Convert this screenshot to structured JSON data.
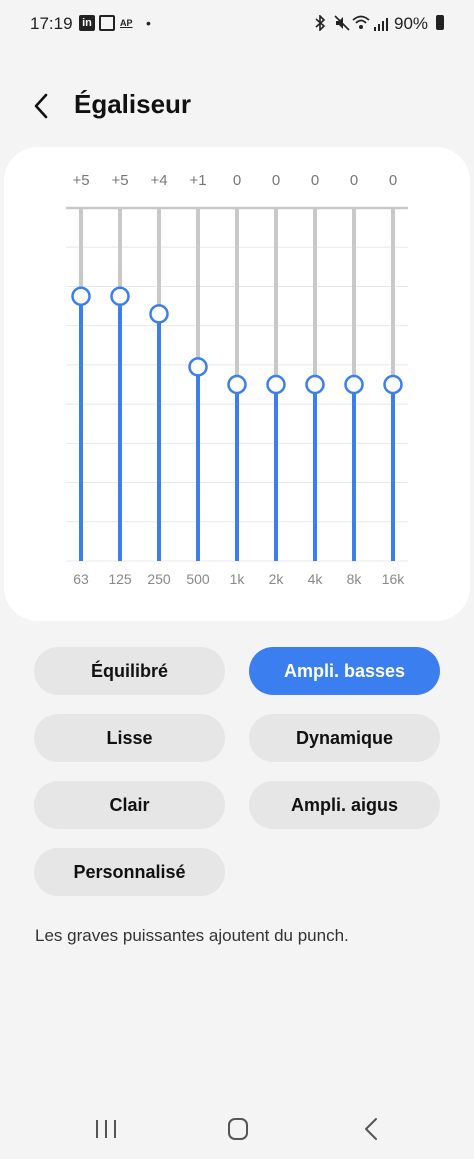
{
  "status_bar": {
    "time": "17:19",
    "battery_text": "90%",
    "icons": [
      "linkedin-icon",
      "calendar-icon",
      "ap-news-icon",
      "dot-icon",
      "bluetooth-icon",
      "mute-icon",
      "wifi-icon",
      "signal-icon",
      "battery-icon"
    ],
    "linkedin_glyph": "in",
    "ap_glyph": "AP",
    "dot_glyph": "•"
  },
  "header": {
    "title": "Égaliseur"
  },
  "equalizer": {
    "bands": [
      {
        "freq": "63",
        "value_label": "+5",
        "value": 5
      },
      {
        "freq": "125",
        "value_label": "+5",
        "value": 5
      },
      {
        "freq": "250",
        "value_label": "+4",
        "value": 4
      },
      {
        "freq": "500",
        "value_label": "+1",
        "value": 1
      },
      {
        "freq": "1k",
        "value_label": "0",
        "value": 0
      },
      {
        "freq": "2k",
        "value_label": "0",
        "value": 0
      },
      {
        "freq": "4k",
        "value_label": "0",
        "value": 0
      },
      {
        "freq": "8k",
        "value_label": "0",
        "value": 0
      },
      {
        "freq": "16k",
        "value_label": "0",
        "value": 0
      }
    ],
    "range": [
      -10,
      10
    ],
    "colors": {
      "active": "#3b7ef0",
      "track": "#c8c8c8",
      "grid": "#e8e8e8",
      "knob_fill": "#ffffff"
    }
  },
  "presets": [
    {
      "label": "Équilibré",
      "active": false
    },
    {
      "label": "Ampli. basses",
      "active": true
    },
    {
      "label": "Lisse",
      "active": false
    },
    {
      "label": "Dynamique",
      "active": false
    },
    {
      "label": "Clair",
      "active": false
    },
    {
      "label": "Ampli. aigus",
      "active": false
    },
    {
      "label": "Personnalisé",
      "active": false
    }
  ],
  "description": "Les graves puissantes ajoutent du punch.",
  "nav": {
    "icons": [
      "recent-apps-icon",
      "home-icon",
      "back-icon"
    ]
  }
}
